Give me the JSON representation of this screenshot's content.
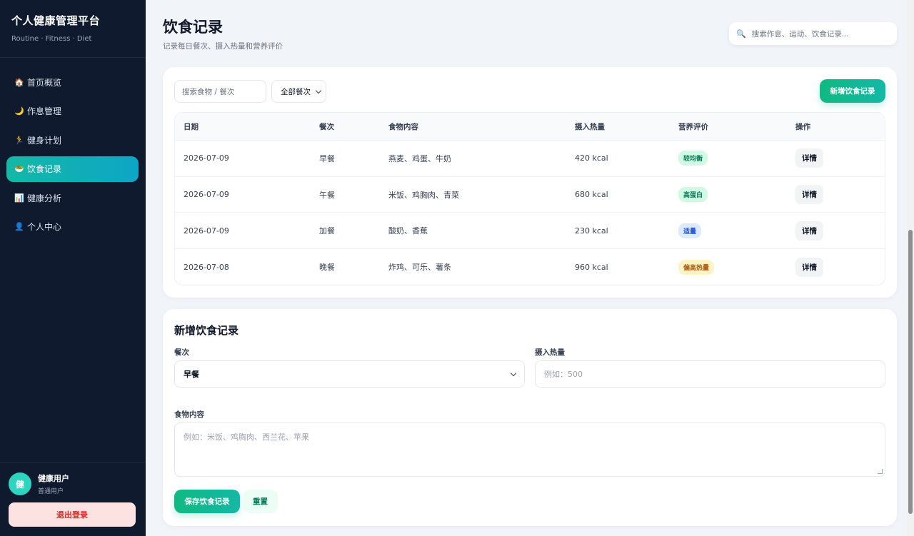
{
  "sidebar": {
    "brand_title": "个人健康管理平台",
    "brand_sub": "Routine · Fitness · Diet",
    "items": [
      {
        "icon": "🏠",
        "label": "首页概览"
      },
      {
        "icon": "🌙",
        "label": "作息管理"
      },
      {
        "icon": "🏃",
        "label": "健身计划"
      },
      {
        "icon": "🥗",
        "label": "饮食记录"
      },
      {
        "icon": "📊",
        "label": "健康分析"
      },
      {
        "icon": "👤",
        "label": "个人中心"
      }
    ],
    "active_index": 3,
    "user": {
      "avatar": "健",
      "name": "健康用户",
      "role": "普通用户"
    },
    "logout_label": "退出登录"
  },
  "header": {
    "title": "饮食记录",
    "subtitle": "记录每日餐次、摄入热量和营养评价",
    "search_placeholder": "搜索作息、运动、饮食记录..."
  },
  "records": {
    "filter_placeholder": "搜索食物 / 餐次",
    "meal_filter": "全部餐次",
    "add_button": "新增饮食记录",
    "columns": [
      "日期",
      "餐次",
      "食物内容",
      "摄入热量",
      "营养评价",
      "操作"
    ],
    "rows": [
      {
        "date": "2026-07-09",
        "meal": "早餐",
        "food": "燕麦、鸡蛋、牛奶",
        "kcal": "420 kcal",
        "rating": "较均衡",
        "tone": "green",
        "action": "详情"
      },
      {
        "date": "2026-07-09",
        "meal": "午餐",
        "food": "米饭、鸡胸肉、青菜",
        "kcal": "680 kcal",
        "rating": "高蛋白",
        "tone": "green",
        "action": "详情"
      },
      {
        "date": "2026-07-09",
        "meal": "加餐",
        "food": "酸奶、香蕉",
        "kcal": "230 kcal",
        "rating": "适量",
        "tone": "blue",
        "action": "详情"
      },
      {
        "date": "2026-07-08",
        "meal": "晚餐",
        "food": "炸鸡、可乐、薯条",
        "kcal": "960 kcal",
        "rating": "偏高热量",
        "tone": "amber",
        "action": "详情"
      }
    ]
  },
  "form": {
    "title": "新增饮食记录",
    "meal_label": "餐次",
    "meal_value": "早餐",
    "kcal_label": "摄入热量",
    "kcal_placeholder": "例如：500",
    "food_label": "食物内容",
    "food_placeholder": "例如：米饭、鸡胸肉、西兰花、苹果",
    "save_label": "保存饮食记录",
    "reset_label": "重置"
  },
  "colors": {
    "sidebar_bg": "#0f1a2e",
    "accent": "#14b8a6",
    "danger": "#dc2626"
  }
}
